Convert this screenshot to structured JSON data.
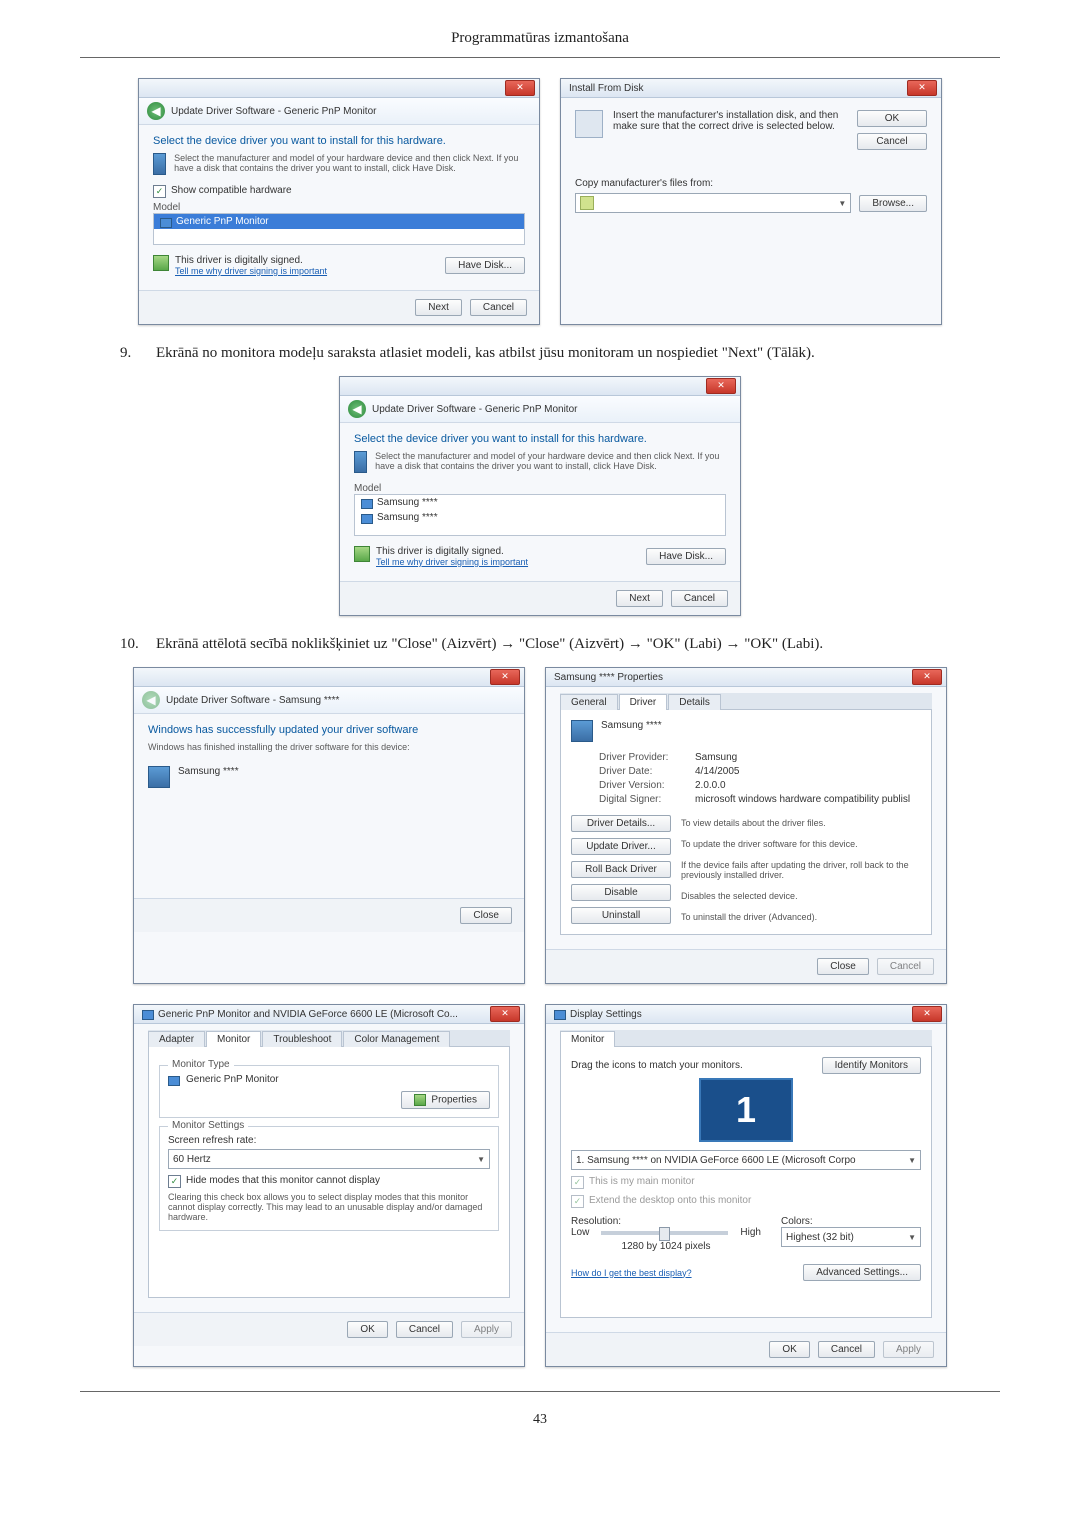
{
  "page": {
    "header": "Programmatūras izmantošana",
    "footer": "43"
  },
  "step9": {
    "num": "9.",
    "text": "Ekrānā no monitora modeļu saraksta atlasiet modeli, kas atbilst jūsu monitoram un nospiediet \"Next\" (Tālāk)."
  },
  "step10": {
    "num": "10.",
    "text": "Ekrānā attēlotā secībā noklikšķiniet uz \"Close\" (Aizvērt) → \"Close\" (Aizvērt) → \"OK\" (Labi) → \"OK\" (Labi)."
  },
  "updateDriver1": {
    "navTitle": "Update Driver Software - Generic PnP Monitor",
    "heading": "Select the device driver you want to install for this hardware.",
    "desc": "Select the manufacturer and model of your hardware device and then click Next. If you have a disk that contains the driver you want to install, click Have Disk.",
    "showCompat": "Show compatible hardware",
    "colModel": "Model",
    "item1": "Generic PnP Monitor",
    "signed": "This driver is digitally signed.",
    "signedLink": "Tell me why driver signing is important",
    "haveDisk": "Have Disk...",
    "next": "Next",
    "cancel": "Cancel"
  },
  "installFromDisk": {
    "title": "Install From Disk",
    "text": "Insert the manufacturer's installation disk, and then make sure that the correct drive is selected below.",
    "ok": "OK",
    "cancel": "Cancel",
    "copyLabel": "Copy manufacturer's files from:",
    "browse": "Browse..."
  },
  "updateDriver2": {
    "navTitle": "Update Driver Software - Generic PnP Monitor",
    "heading": "Select the device driver you want to install for this hardware.",
    "desc": "Select the manufacturer and model of your hardware device and then click Next. If you have a disk that contains the driver you want to install, click Have Disk.",
    "colModel": "Model",
    "item1": "Samsung ****",
    "item2": "Samsung ****",
    "signed": "This driver is digitally signed.",
    "signedLink": "Tell me why driver signing is important",
    "haveDisk": "Have Disk...",
    "next": "Next",
    "cancel": "Cancel"
  },
  "updateDriver3": {
    "navTitle": "Update Driver Software - Samsung ****",
    "heading": "Windows has successfully updated your driver software",
    "desc": "Windows has finished installing the driver software for this device:",
    "device": "Samsung ****",
    "close": "Close"
  },
  "propsDialog": {
    "title": "Samsung **** Properties",
    "tabs": {
      "general": "General",
      "driver": "Driver",
      "details": "Details"
    },
    "device": "Samsung ****",
    "provLbl": "Driver Provider:",
    "provVal": "Samsung",
    "dateLbl": "Driver Date:",
    "dateVal": "4/14/2005",
    "verLbl": "Driver Version:",
    "verVal": "2.0.0.0",
    "sigLbl": "Digital Signer:",
    "sigVal": "microsoft windows hardware compatibility publisl",
    "btnDetails": "Driver Details...",
    "btnDetailsDesc": "To view details about the driver files.",
    "btnUpdate": "Update Driver...",
    "btnUpdateDesc": "To update the driver software for this device.",
    "btnRoll": "Roll Back Driver",
    "btnRollDesc": "If the device fails after updating the driver, roll back to the previously installed driver.",
    "btnDisable": "Disable",
    "btnDisableDesc": "Disables the selected device.",
    "btnUninstall": "Uninstall",
    "btnUninstallDesc": "To uninstall the driver (Advanced).",
    "close": "Close",
    "cancel": "Cancel"
  },
  "monitorProps": {
    "title": "Generic PnP Monitor and NVIDIA GeForce 6600 LE (Microsoft Co...",
    "tabs": {
      "adapter": "Adapter",
      "monitor": "Monitor",
      "troubleshoot": "Troubleshoot",
      "color": "Color Management"
    },
    "typeLegend": "Monitor Type",
    "typeVal": "Generic PnP Monitor",
    "propsBtn": "Properties",
    "settingsLegend": "Monitor Settings",
    "refreshLbl": "Screen refresh rate:",
    "refreshVal": "60 Hertz",
    "hideChk": "Hide modes that this monitor cannot display",
    "hideDesc": "Clearing this check box allows you to select display modes that this monitor cannot display correctly. This may lead to an unusable display and/or damaged hardware.",
    "ok": "OK",
    "cancel": "Cancel",
    "apply": "Apply"
  },
  "displaySettings": {
    "title": "Display Settings",
    "tab": "Monitor",
    "dragText": "Drag the icons to match your monitors.",
    "identify": "Identify Monitors",
    "monNum": "1",
    "monSelect": "1. Samsung **** on NVIDIA GeForce 6600 LE (Microsoft Corpo",
    "mainChk": "This is my main monitor",
    "extendChk": "Extend the desktop onto this monitor",
    "resLbl": "Resolution:",
    "low": "Low",
    "high": "High",
    "resVal": "1280 by 1024 pixels",
    "colLbl": "Colors:",
    "colVal": "Highest (32 bit)",
    "helpLink": "How do I get the best display?",
    "advanced": "Advanced Settings...",
    "ok": "OK",
    "cancel": "Cancel",
    "apply": "Apply"
  }
}
